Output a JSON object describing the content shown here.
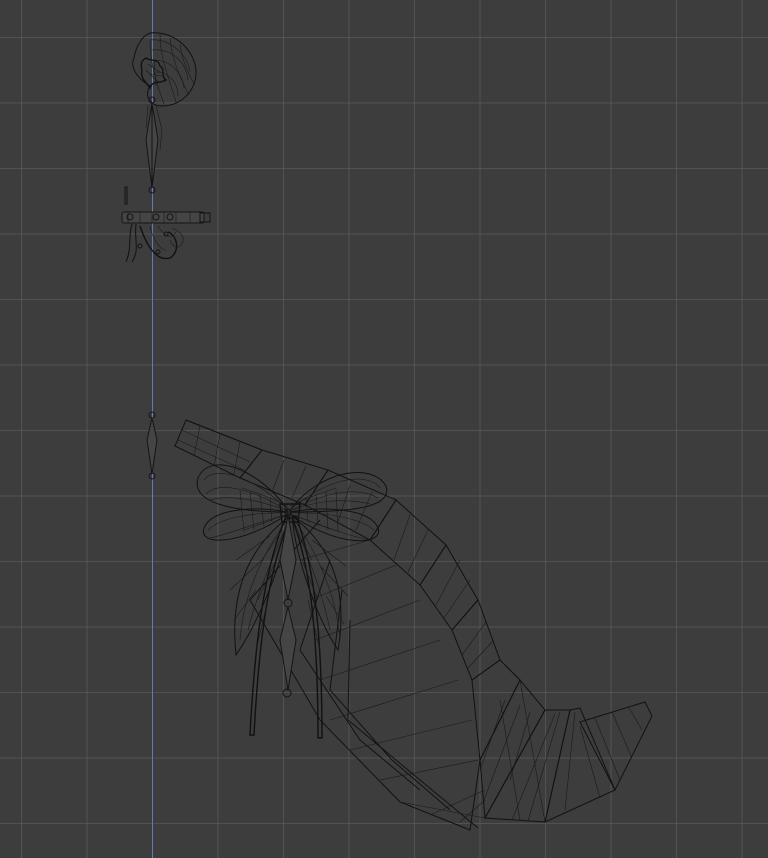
{
  "viewport": {
    "background": "#3d3d3d",
    "grid_color": "#5a5a5a",
    "axis_color": "#5b7fb2",
    "wire_color": "#121212"
  },
  "objects": [
    {
      "name": "hair-bun",
      "icon": "wireframe-mesh"
    },
    {
      "name": "hairpin-accessory",
      "icon": "wireframe-mesh"
    },
    {
      "name": "ribbon-bow",
      "icon": "wireframe-mesh"
    },
    {
      "name": "ponytail",
      "icon": "wireframe-mesh"
    },
    {
      "name": "armature",
      "icon": "bone"
    }
  ]
}
